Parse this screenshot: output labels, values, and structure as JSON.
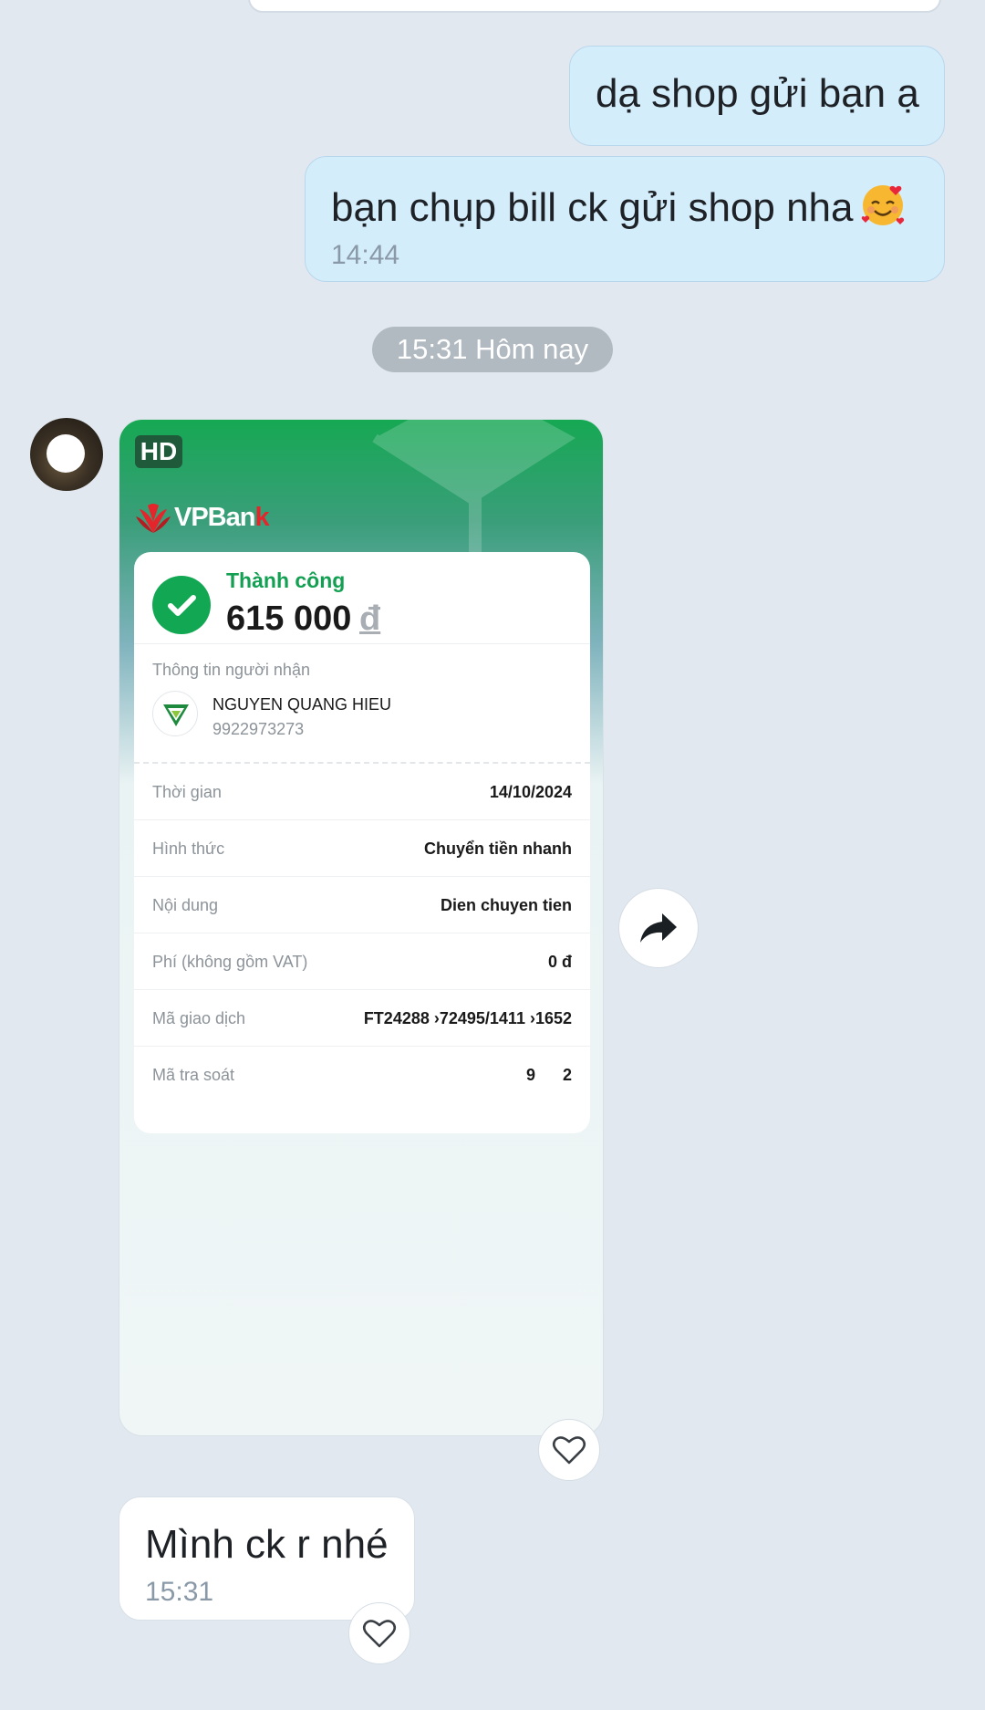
{
  "messages": {
    "out1": {
      "text": "dạ shop gửi bạn ạ"
    },
    "out2": {
      "text": "bạn chụp bill ck gửi shop nha",
      "emoji": "smiling-face-with-hearts",
      "time": "14:44"
    },
    "in1": {
      "text": "Mình ck r nhé",
      "time": "15:31"
    }
  },
  "date_separator": "15:31 Hôm nay",
  "receipt": {
    "hd_badge": "HD",
    "bank_logo": {
      "prefix": "VPBan",
      "suffix": "k"
    },
    "status": "Thành công",
    "amount": "615 000",
    "currency": "đ",
    "recipient_label": "Thông tin người nhận",
    "recipient_name": "NGUYEN QUANG HIEU",
    "recipient_account": "9922973273",
    "details": [
      {
        "key": "Thời gian",
        "value": "14/10/2024"
      },
      {
        "key": "Hình thức",
        "value": "Chuyển tiền nhanh"
      },
      {
        "key": "Nội dung",
        "value": "Dien chuyen tien"
      },
      {
        "key": "Phí (không gồm VAT)",
        "value": "0 đ"
      },
      {
        "key": "Mã giao dịch",
        "value": "FT24288  ›72495/1411  ›1652"
      },
      {
        "key": "Mã tra soát",
        "value": "9      2"
      }
    ]
  },
  "icons": {
    "forward": "forward-arrow-icon",
    "heart": "heart-outline-icon"
  },
  "colors": {
    "background": "#e1e8f0",
    "outgoing_bubble": "#d4edfb",
    "success_green": "#12a853",
    "vpbank_red": "#e4262c"
  }
}
